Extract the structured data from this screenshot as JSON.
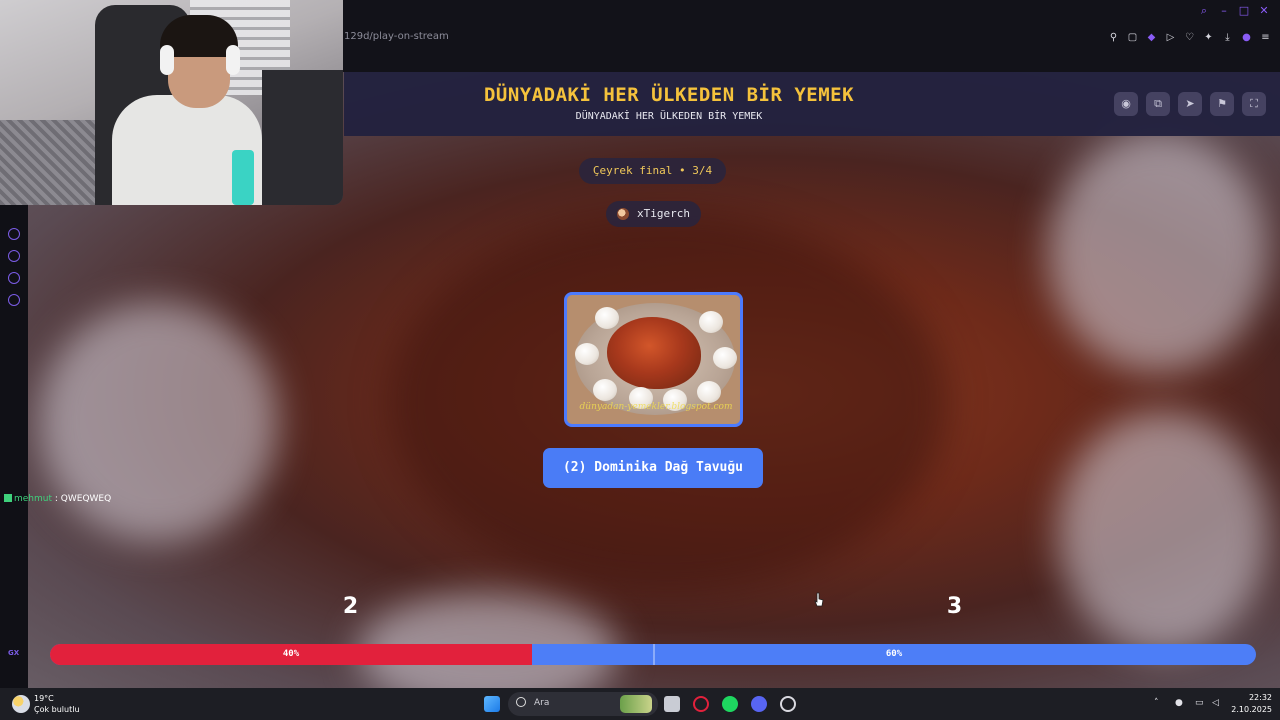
{
  "browser": {
    "url_fragment": "129d/play-on-stream"
  },
  "game": {
    "title": "DÜNYADAKİ HER ÜLKEDEN BİR YEMEK",
    "subtitle": "DÜNYADAKİ HER ÜLKEDEN BİR YEMEK",
    "round_label": "Çeyrek final • 3/4",
    "player_name": "xTigerch",
    "food_watermark": "dünyadan-yemekler.blogspot.com",
    "answer_label": "(2) Dominika Dağ Tavuğu",
    "score_left": "2",
    "score_right": "3",
    "vote_left_percent": 40,
    "vote_right_percent": 60,
    "vote_left_label": "40%",
    "vote_right_label": "60%",
    "header_buttons": [
      "eye-icon",
      "share-icon",
      "send-icon",
      "flag-icon",
      "fullscreen-icon"
    ]
  },
  "chat": {
    "user": "mehmut",
    "separator": " : ",
    "message": "QWEQWEQ"
  },
  "sidebar": {
    "footer_label": "GX"
  },
  "taskbar": {
    "weather_temp": "19°C",
    "weather_desc": "Çok bulutlu",
    "search_placeholder": "Ara",
    "time": "22:32",
    "date": "2.10.2025"
  },
  "colors": {
    "title_yellow": "#f5c23c",
    "vote_red": "#e2213c",
    "vote_blue": "#4d7ef7",
    "answer_blue": "#4a7cf6",
    "accent_purple": "#8a5cf6"
  }
}
